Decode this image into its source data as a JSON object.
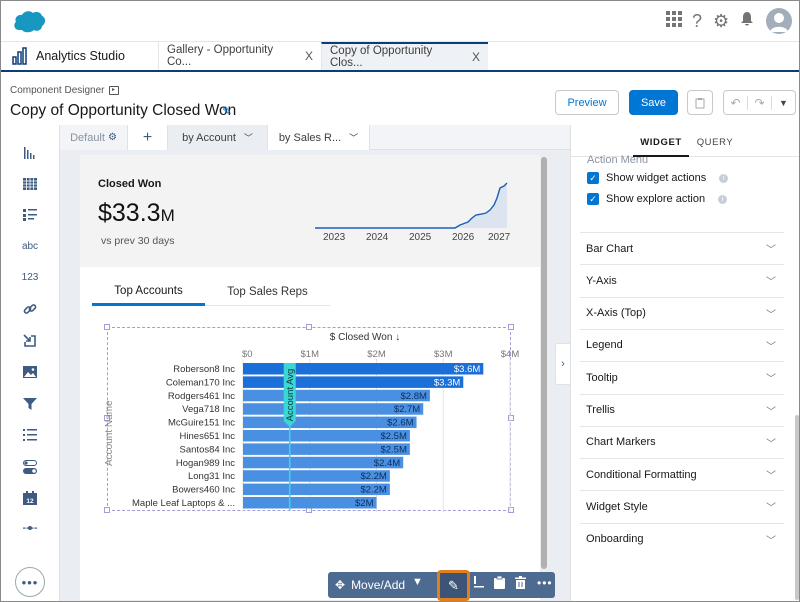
{
  "global_header": {
    "icons": [
      "salesforce-cloud-logo",
      "app-launcher-icon",
      "help-icon",
      "setup-gear-icon",
      "notifications-bell-icon",
      "user-avatar-icon"
    ],
    "help_glyph": "?"
  },
  "tabs": {
    "app_name": "Analytics Studio",
    "items": [
      {
        "label": "Gallery - Opportunity Co...",
        "active": false,
        "close": "X"
      },
      {
        "label": "Copy of Opportunity Clos...",
        "active": true,
        "close": "X"
      }
    ]
  },
  "designer": {
    "breadcrumb": "Component Designer",
    "title": "Copy of Opportunity Closed Won",
    "preview_label": "Preview",
    "save_label": "Save"
  },
  "palette": {
    "items": [
      "chart-icon",
      "table-icon",
      "list-icon",
      "text-icon",
      "number-icon",
      "link-icon",
      "component-icon",
      "image-icon",
      "filter-icon",
      "list-selector-icon",
      "toggle-icon",
      "date-icon",
      "range-icon"
    ],
    "text_glyph": "abc",
    "number_glyph": "123",
    "more_glyph": "•••"
  },
  "page_tabs": {
    "default_label": "Default",
    "add_label": "+",
    "items": [
      {
        "label": "by Account",
        "active": true
      },
      {
        "label": "by Sales R...",
        "active": false
      }
    ]
  },
  "kpi": {
    "label": "Closed Won",
    "value": "$33.3",
    "unit": "M",
    "subtext": "vs prev 30 days",
    "sparkline_years": [
      "2023",
      "2024",
      "2025",
      "2026",
      "2027"
    ]
  },
  "inner_tabs": [
    {
      "label": "Top Accounts",
      "active": true
    },
    {
      "label": "Top Sales Reps",
      "active": false
    }
  ],
  "chart_data": {
    "type": "bar",
    "orientation": "horizontal",
    "title": "$ Closed Won ↓",
    "xlabel": "$ Closed Won",
    "ylabel": "Account Name",
    "xlim": [
      0,
      4
    ],
    "x_unit": "M",
    "x_ticks": [
      "$0",
      "$1M",
      "$2M",
      "$3M",
      "$4M"
    ],
    "reference_line": {
      "label": "Account Avg",
      "value": 0.7
    },
    "categories": [
      "Roberson8 Inc",
      "Coleman170 Inc",
      "Rodgers461 Inc",
      "Vega718 Inc",
      "McGuire151 Inc",
      "Hines651 Inc",
      "Santos84 Inc",
      "Hogan989 Inc",
      "Long31 Inc",
      "Bowers460 Inc",
      "Maple Leaf Laptops & ..."
    ],
    "values": [
      3.6,
      3.3,
      2.8,
      2.7,
      2.6,
      2.5,
      2.5,
      2.4,
      2.2,
      2.2,
      2.0
    ],
    "data_labels": [
      "$3.6M",
      "$3.3M",
      "$2.8M",
      "$2.7M",
      "$2.6M",
      "$2.5M",
      "$2.5M",
      "$2.4M",
      "$2.2M",
      "$2.2M",
      "$2M"
    ],
    "colors": {
      "top": "#1b6fd8",
      "rest": "#4a90e2",
      "reference": "#3bd6d6"
    }
  },
  "widget_toolbar": {
    "move_label": "Move/Add"
  },
  "right_panel": {
    "tabs": [
      {
        "label": "WIDGET",
        "active": true
      },
      {
        "label": "QUERY",
        "active": false
      }
    ],
    "action_menu_label": "Action Menu",
    "checkboxes": [
      {
        "label": "Show widget actions",
        "checked": true
      },
      {
        "label": "Show explore action",
        "checked": true
      }
    ],
    "sections": [
      "Bar Chart",
      "Y-Axis",
      "X-Axis (Top)",
      "Legend",
      "Tooltip",
      "Trellis",
      "Chart Markers",
      "Conditional Formatting",
      "Widget Style",
      "Onboarding"
    ]
  }
}
